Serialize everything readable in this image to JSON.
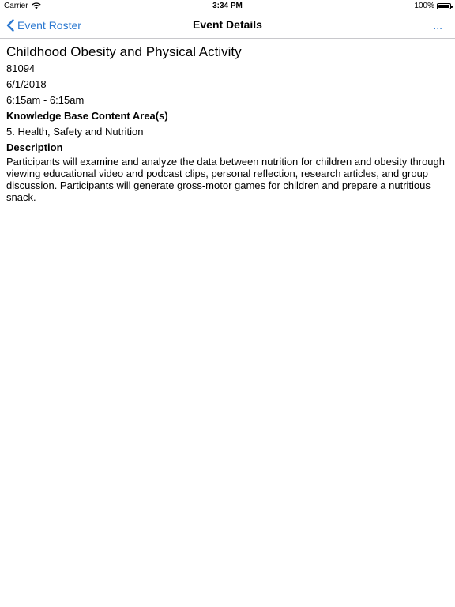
{
  "status_bar": {
    "carrier": "Carrier",
    "time": "3:34 PM",
    "battery": "100%"
  },
  "nav": {
    "back_label": "Event Roster",
    "title": "Event Details",
    "more_label": "..."
  },
  "event": {
    "title": "Childhood Obesity and Physical Activity",
    "id": "81094",
    "date": "6/1/2018",
    "time_range": "6:15am - 6:15am",
    "content_area_heading": "Knowledge Base Content Area(s)",
    "content_area": "5. Health, Safety and Nutrition",
    "description_heading": "Description",
    "description": "Participants will examine and analyze the data between nutrition for children and obesity through viewing educational video and podcast clips, personal reflection, research articles, and group discussion. Participants will generate gross-motor games for children and prepare a nutritious snack."
  },
  "colors": {
    "accent": "#2e7ad1",
    "separator": "#c8c8cc"
  },
  "icons": {
    "back": "chevron-left-icon",
    "wifi": "wifi-icon",
    "battery": "battery-icon"
  }
}
